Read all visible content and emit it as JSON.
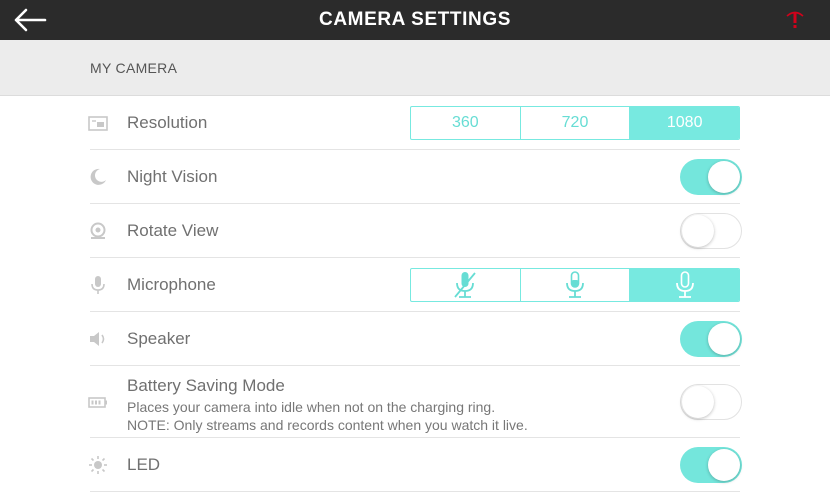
{
  "header": {
    "title": "CAMERA SETTINGS"
  },
  "section": {
    "title": "MY CAMERA"
  },
  "settings": {
    "resolution": {
      "label": "Resolution",
      "options": [
        "360",
        "720",
        "1080"
      ],
      "selected": "1080"
    },
    "night_vision": {
      "label": "Night Vision",
      "state": "on"
    },
    "rotate_view": {
      "label": "Rotate View",
      "state": "off"
    },
    "microphone": {
      "label": "Microphone",
      "options": [
        "microphone-muted-icon",
        "microphone-low-icon",
        "microphone-high-icon"
      ],
      "selected": "microphone-high-icon"
    },
    "speaker": {
      "label": "Speaker",
      "state": "on"
    },
    "battery_saving": {
      "label": "Battery Saving Mode",
      "description_line1": "Places your camera into idle when not on the charging ring.",
      "description_line2": "NOTE: Only streams and records content when you watch it live.",
      "state": "off"
    },
    "led": {
      "label": "LED",
      "state": "on"
    }
  },
  "colors": {
    "accent": "#77e9e0",
    "topbar": "#2b2b2b",
    "alert": "#d0021b"
  }
}
